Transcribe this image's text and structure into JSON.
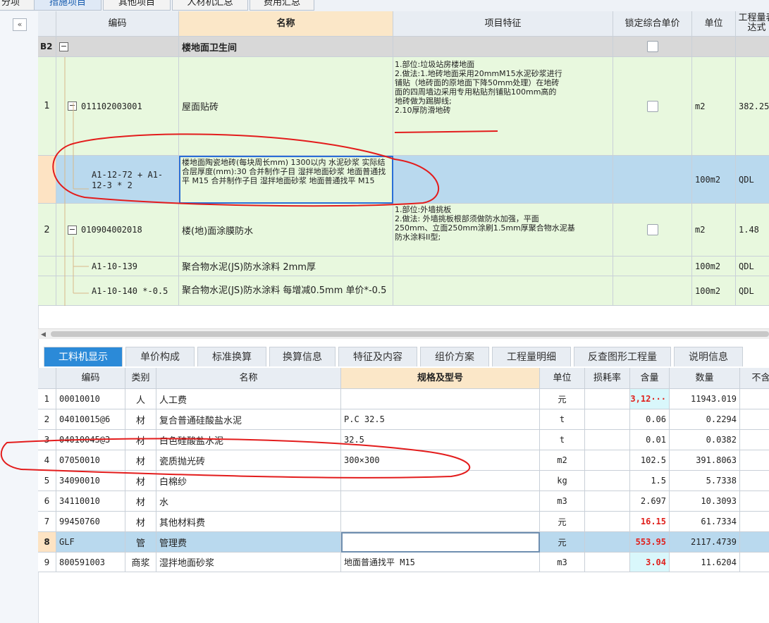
{
  "top_tabs": [
    "分项",
    "措施项目",
    "其他项目",
    "人材机汇总",
    "费用汇总"
  ],
  "collapse_label": "«",
  "upper": {
    "headers": [
      "编码",
      "名称",
      "项目特征",
      "锁定综合单价",
      "单位",
      "工程量表达式"
    ],
    "group": {
      "code": "B2",
      "name": "楼地面卫生间"
    },
    "rows": [
      {
        "index": "1",
        "code": "011102003001",
        "name": "屋面贴砖",
        "feature": [
          "1.部位:垃圾站房楼地面",
          "2.做法:1.地砖地面采用20mmM15水泥砂浆进行",
          "铺贴（地砖面的原地面下降50mm处理）在地砖",
          "面的四周墙边采用专用粘贴剂铺贴100mm高的",
          "地砖做为踢脚线;",
          "2.10厚防滑地砖"
        ],
        "unit": "m2",
        "qty": "382.25"
      },
      {
        "index": "",
        "code": "A1-12-72 + A1-12-3 * 2",
        "name": "楼地面陶瓷地砖(每块周长mm) 1300以内 水泥砂浆 实际结合层厚度(mm):30 合并制作子目 湿拌地面砂浆 地面普通找平 M15 合并制作子目 湿拌地面砂浆 地面普通找平 M15",
        "feature": [],
        "unit": "100m2",
        "qty": "QDL"
      },
      {
        "index": "2",
        "code": "010904002018",
        "name": "楼(地)面涂膜防水",
        "feature": [
          "1.部位:外墙挑板",
          "2.做法: 外墙挑板根部须做防水加强，平面",
          "250mm、立面250mm涂刷1.5mm厚聚合物水泥基",
          "防水涂料II型;"
        ],
        "unit": "m2",
        "qty": "1.48"
      },
      {
        "index": "",
        "code": "A1-10-139",
        "name": "聚合物水泥(JS)防水涂料 2mm厚",
        "feature": [],
        "unit": "100m2",
        "qty": "QDL"
      },
      {
        "index": "",
        "code": "A1-10-140 *-0.5",
        "name": "聚合物水泥(JS)防水涂料 每增减0.5mm 单价*-0.5",
        "feature": [],
        "unit": "100m2",
        "qty": "QDL"
      }
    ]
  },
  "lower": {
    "tabs": [
      "工料机显示",
      "单价构成",
      "标准换算",
      "换算信息",
      "特征及内容",
      "组价方案",
      "工程量明细",
      "反查图形工程量",
      "说明信息"
    ],
    "headers": [
      "编码",
      "类别",
      "名称",
      "规格及型号",
      "单位",
      "损耗率",
      "含量",
      "数量",
      "不含"
    ],
    "rows": [
      {
        "index": "1",
        "code": "00010010",
        "type": "人",
        "name": "人工费",
        "spec": "",
        "unit": "元",
        "loss": "",
        "content": "3,12···",
        "amount": "11943.019"
      },
      {
        "index": "2",
        "code": "04010015@6",
        "type": "材",
        "name": "复合普通硅酸盐水泥",
        "spec": "P.C 32.5",
        "unit": "t",
        "loss": "",
        "content": "0.06",
        "amount": "0.2294"
      },
      {
        "index": "3",
        "code": "04010045@3",
        "type": "材",
        "name": "白色硅酸盐水泥",
        "spec": "32.5",
        "unit": "t",
        "loss": "",
        "content": "0.01",
        "amount": "0.0382"
      },
      {
        "index": "4",
        "code": "07050010",
        "type": "材",
        "name": "瓷质抛光砖",
        "spec": "300×300",
        "unit": "m2",
        "loss": "",
        "content": "102.5",
        "amount": "391.8063"
      },
      {
        "index": "5",
        "code": "34090010",
        "type": "材",
        "name": "白棉纱",
        "spec": "",
        "unit": "kg",
        "loss": "",
        "content": "1.5",
        "amount": "5.7338"
      },
      {
        "index": "6",
        "code": "34110010",
        "type": "材",
        "name": "水",
        "spec": "",
        "unit": "m3",
        "loss": "",
        "content": "2.697",
        "amount": "10.3093"
      },
      {
        "index": "7",
        "code": "99450760",
        "type": "材",
        "name": "其他材料费",
        "spec": "",
        "unit": "元",
        "loss": "",
        "content": "16.15",
        "amount": "61.7334"
      },
      {
        "index": "8",
        "code": "GLF",
        "type": "管",
        "name": "管理费",
        "spec": "",
        "unit": "元",
        "loss": "",
        "content": "553.95",
        "amount": "2117.4739"
      },
      {
        "index": "9",
        "code": "800591003",
        "type": "商浆",
        "name": "湿拌地面砂浆",
        "spec": "地面普通找平 M15",
        "unit": "m3",
        "loss": "",
        "content": "3.04",
        "amount": "11.6204"
      }
    ]
  }
}
